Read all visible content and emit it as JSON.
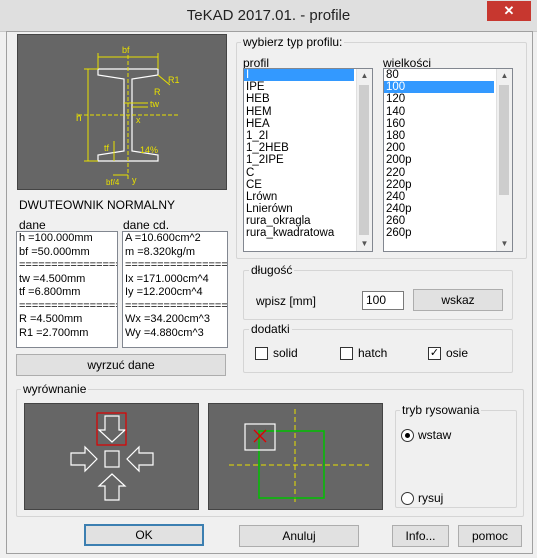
{
  "window": {
    "title": "TeKAD 2017.01. - profile",
    "close_glyph": "✕"
  },
  "profile_name": "DWUTEOWNIK NORMALNY",
  "drawing": {
    "labels": {
      "bf": "bf",
      "r1": "R1",
      "r": "R",
      "tw": "tw",
      "x": "x",
      "h": "h",
      "tf": "tf",
      "y": "y",
      "slope": "14%",
      "bf4": "bf/4"
    }
  },
  "dane": {
    "label": "dane",
    "lines": [
      "h =100.000mm",
      "bf =50.000mm",
      "==================",
      "tw =4.500mm",
      "tf =6.800mm",
      "==================",
      "R =4.500mm",
      "R1 =2.700mm"
    ]
  },
  "dane_cd": {
    "label": "dane cd.",
    "lines": [
      "A =10.600cm^2",
      "m =8.320kg/m",
      "==================",
      "Ix =171.000cm^4",
      "Iy =12.200cm^4",
      "==================",
      "Wx =34.200cm^3",
      "Wy =4.880cm^3"
    ]
  },
  "wyrzuc_button": "wyrzuć dane",
  "typ_group": {
    "label": "wybierz typ profilu:"
  },
  "profil": {
    "label": "profil",
    "items": [
      "I",
      "IPE",
      "HEB",
      "HEM",
      "HEA",
      "1_2I",
      "1_2HEB",
      "1_2IPE",
      "C",
      "CE",
      "Lrówn",
      "Lnierówn",
      "rura_okragla",
      "rura_kwadratowa"
    ],
    "selected_index": 0
  },
  "wielkosci": {
    "label": "wielkości",
    "items": [
      "80",
      "100",
      "120",
      "140",
      "160",
      "180",
      "200",
      "200p",
      "220",
      "220p",
      "240",
      "240p",
      "260",
      "260p"
    ],
    "selected_index": 1
  },
  "dlugosc": {
    "label": "długość",
    "wpisz_label": "wpisz [mm]",
    "value": "100",
    "button": "wskaz"
  },
  "dodatki": {
    "label": "dodatki",
    "items": [
      {
        "label": "solid",
        "checked": false
      },
      {
        "label": "hatch",
        "checked": false
      },
      {
        "label": "osie",
        "checked": true
      }
    ],
    "check_glyph": "✓"
  },
  "wyrownanie": {
    "label": "wyrównanie"
  },
  "tryb": {
    "label": "tryb rysowania",
    "options": [
      {
        "label": "wstaw",
        "selected": true
      },
      {
        "label": "rysuj",
        "selected": false
      }
    ]
  },
  "buttons": {
    "ok": "OK",
    "anuluj": "Anuluj",
    "info": "Info...",
    "pomoc": "pomoc"
  },
  "colors": {
    "preview_bg": "#666666",
    "dim_yellow": "#e8e000",
    "drawing_white": "#ffffff",
    "marker_red": "#e00000",
    "marker_green": "#00c000",
    "selection_blue": "#3399ff"
  }
}
